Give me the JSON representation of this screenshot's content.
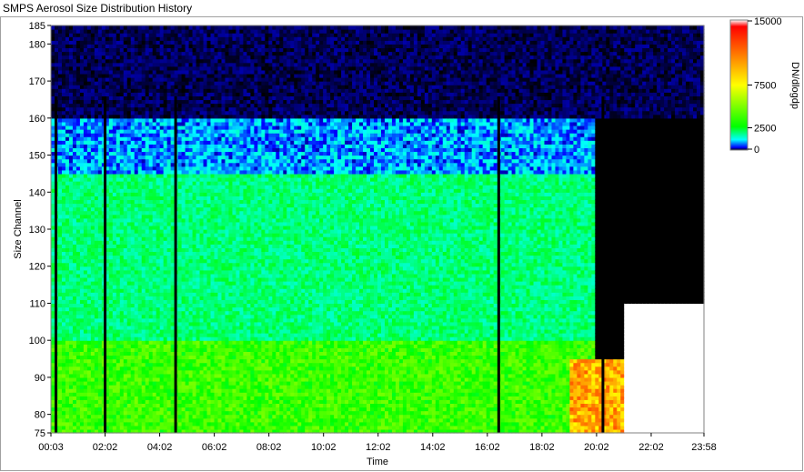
{
  "window": {
    "title": "SMPS Aerosol Size Distribution History"
  },
  "chart_data": {
    "type": "heatmap",
    "title": "SMPS Aerosol Size Distribution History",
    "xlabel": "Time",
    "ylabel": "Size Channel",
    "x_ticks": [
      "00:03",
      "02:02",
      "04:02",
      "06:02",
      "08:02",
      "10:02",
      "12:02",
      "14:02",
      "16:02",
      "18:02",
      "20:02",
      "22:02",
      "23:58"
    ],
    "x_range": [
      "00:03",
      "23:58"
    ],
    "y_ticks": [
      75,
      80,
      90,
      100,
      110,
      120,
      130,
      140,
      150,
      160,
      170,
      180,
      185
    ],
    "y_range": [
      75,
      185
    ],
    "colorbar": {
      "label": "DN/dlogdp",
      "ticks": [
        "0",
        "2500",
        "7500",
        "15000"
      ],
      "range": [
        0,
        15000
      ],
      "colors": [
        "#000000",
        "#0000ff",
        "#00ffff",
        "#00ff00",
        "#ffff00",
        "#ff0000",
        "#ffffff"
      ]
    },
    "gap_times": [
      "00:14",
      "02:02",
      "04:37",
      "16:27",
      "20:16"
    ],
    "regions": [
      {
        "time": "00:03-20:00",
        "channels": "75-100",
        "value_range": [
          2500,
          5000
        ]
      },
      {
        "time": "00:03-20:00",
        "channels": "100-145",
        "value_range": [
          1500,
          2500
        ]
      },
      {
        "time": "00:03-20:00",
        "channels": "145-160",
        "value_range": [
          200,
          1500
        ]
      },
      {
        "time": "00:03-23:58",
        "channels": "160-185",
        "value_range": [
          0,
          200
        ]
      },
      {
        "time": "19:00-21:00",
        "channels": "75-95",
        "value_range": [
          7500,
          12000
        ]
      },
      {
        "time": "21:00-23:58",
        "channels": "75-110",
        "value_range": [
          15000,
          15000
        ]
      }
    ]
  }
}
